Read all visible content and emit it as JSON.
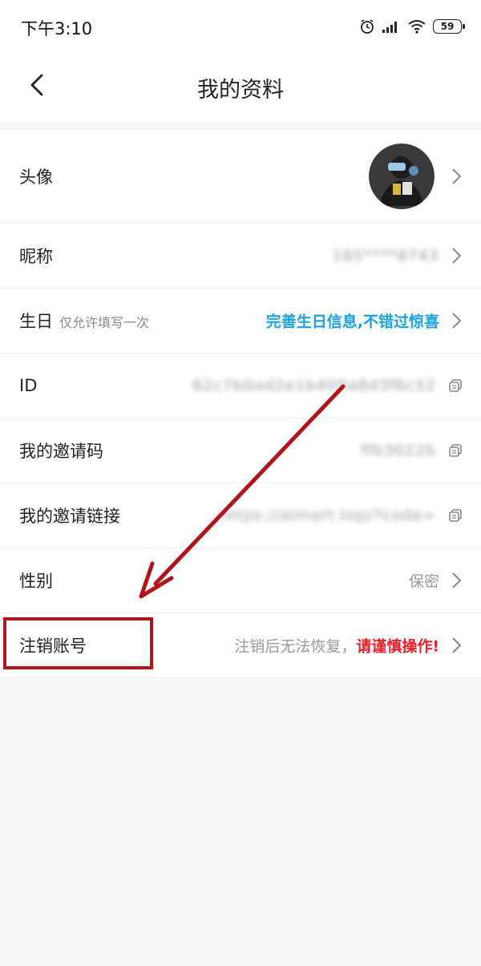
{
  "status_bar": {
    "time": "下午3:10",
    "battery": "59"
  },
  "header": {
    "title": "我的资料"
  },
  "profile": {
    "avatar_label": "头像",
    "nickname": {
      "label": "昵称",
      "value": "185****8743"
    },
    "birthday": {
      "label": "生日",
      "hint": "仅允许填写一次",
      "value": "完善生日信息,不错过惊喜"
    },
    "id": {
      "label": "ID",
      "value": "62c7b0ad2e1b409a8d3f6c52"
    },
    "invite_code": {
      "label": "我的邀请码",
      "value": "ffb3022b"
    },
    "invite_link": {
      "label": "我的邀请链接",
      "value": "https://aimart.top/?code="
    },
    "gender": {
      "label": "性别",
      "value": "保密"
    },
    "deactivate": {
      "label": "注销账号",
      "value_prefix": "注销后无法恢复，",
      "value_warning": "请谨慎操作!"
    }
  },
  "colors": {
    "accent": "#1ba1e2",
    "warning": "#e8202a",
    "annotation": "#b0151c"
  }
}
